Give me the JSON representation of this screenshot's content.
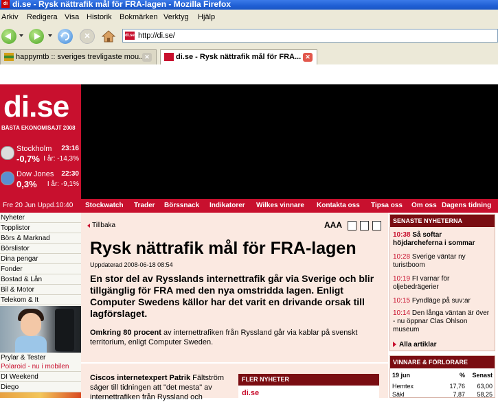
{
  "window": {
    "title": "di.se - Rysk nättrafik mål för FRA-lagen - Mozilla Firefox"
  },
  "menu": [
    "Arkiv",
    "Redigera",
    "Visa",
    "Historik",
    "Bokmärken",
    "Verktyg",
    "Hjälp"
  ],
  "toolbar": {
    "url": "http://di.se/"
  },
  "tabs": [
    {
      "label": "happymtb :: sveriges trevligaste mou...",
      "active": false
    },
    {
      "label": "di.se - Rysk nättrafik mål för FRA...",
      "active": true
    }
  ],
  "site": {
    "logo": "di.se",
    "tagline": "BÄSTA EKONOMISAJT 2008",
    "indices": [
      {
        "name": "Stockholm",
        "time": "23:16",
        "change": "-0,7%",
        "year": "I år: -14,3%"
      },
      {
        "name": "Dow Jones",
        "time": "22:30",
        "change": "0,3%",
        "year": "I år: -9,1%"
      }
    ],
    "date": "Fre 20 Jun Uppd.10:40",
    "nav": [
      "Stockwatch",
      "Trader",
      "Börssnack",
      "Indikatorer",
      "Wilkes vinnare",
      "Kontakta oss",
      "Tipsa oss",
      "Om oss",
      "Dagens tidning"
    ]
  },
  "sidebar": {
    "items": [
      "Nyheter",
      "Topplistor",
      "Börs & Marknad",
      "Börslistor",
      "Dina pengar",
      "Fonder",
      "Bostad & Lån",
      "Bil & Motor",
      "Telekom & It"
    ],
    "after": [
      "Prylar & Tester",
      "Polaroid - nu i mobilen",
      "DI Weekend",
      "Diego"
    ]
  },
  "article": {
    "back": "Tillbaka",
    "text_size": "AAA",
    "title": "Rysk nättrafik mål för FRA-lagen",
    "updated": "Uppdaterad 2008-06-18 08:54",
    "lead": "En stor del av Rysslands internettrafik går via Sverige och blir tillgänglig för FRA med den nya omstridda lagen. Enligt Computer Swedens källor har det varit en drivande orsak till lagförslaget.",
    "para1_bold": "Omkring 80 procent",
    "para1_rest": " av internettrafiken från Ryssland går via kablar på svenskt territorium, enligt Computer Sweden.",
    "para2_bold": "Ciscos internetexpert Patrik",
    "para2_rest": " Fältström säger till tidningen att \"det mesta\" av internettrafiken från Ryssland och"
  },
  "fler": {
    "heading": "FLER NYHETER",
    "item": "di.se"
  },
  "senaste": {
    "heading": "SENASTE NYHETERNA",
    "items": [
      {
        "time": "10:38",
        "text": "Så softar höjdarcheferna i sommar"
      },
      {
        "time": "10:28",
        "text": "Sverige väntar ny turistboom"
      },
      {
        "time": "10:19",
        "text": "FI varnar för oljebedrägerier"
      },
      {
        "time": "10:15",
        "text": "Fyndläge på suv:ar"
      },
      {
        "time": "10:14",
        "text": "Den långa väntan är över - nu öppnar Clas Ohlson museum"
      }
    ],
    "all": "Alla artiklar"
  },
  "vinnare": {
    "heading": "VINNARE & FÖRLORARE",
    "columns": [
      "19 jun",
      "%",
      "Senast"
    ],
    "rows": [
      [
        "Hemtex",
        "17,76",
        "63,00"
      ],
      [
        "Säkl",
        "7,87",
        "58,25"
      ]
    ]
  },
  "colors": {
    "brand": "#c8102e",
    "dark_brand": "#7a0d12",
    "article_bg": "#fbe9e1"
  }
}
